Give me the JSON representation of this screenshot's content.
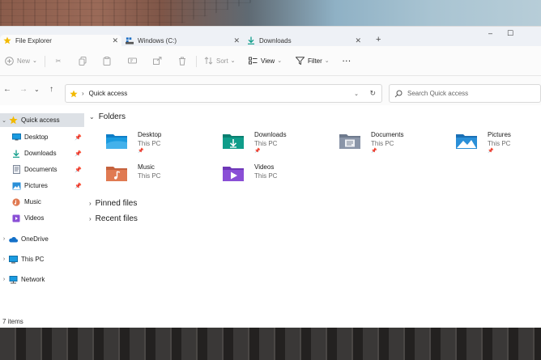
{
  "tabs": [
    {
      "label": "File Explorer",
      "icon": "folder-star-icon",
      "active": true
    },
    {
      "label": "Windows (C:)",
      "icon": "drive-icon",
      "active": false
    },
    {
      "label": "Downloads",
      "icon": "download-icon",
      "active": false
    }
  ],
  "window_controls": {
    "minimize": "–",
    "maximize": "☐"
  },
  "toolbar": {
    "new_label": "New",
    "sort_label": "Sort",
    "view_label": "View",
    "filter_label": "Filter",
    "more_label": "···"
  },
  "address": {
    "location": "Quick access",
    "separator": "›"
  },
  "search": {
    "placeholder": "Search Quick access"
  },
  "nav": {
    "quick_access": "Quick access",
    "pinned": [
      {
        "label": "Desktop",
        "icon": "desktop-icon"
      },
      {
        "label": "Downloads",
        "icon": "download-icon"
      },
      {
        "label": "Documents",
        "icon": "documents-icon"
      },
      {
        "label": "Pictures",
        "icon": "pictures-icon"
      },
      {
        "label": "Music",
        "icon": "music-icon"
      },
      {
        "label": "Videos",
        "icon": "videos-icon"
      }
    ],
    "onedrive": "OneDrive",
    "this_pc": "This PC",
    "network": "Network"
  },
  "main": {
    "folders_header": "Folders",
    "folders": [
      {
        "name": "Desktop",
        "location": "This PC",
        "icon": "desktop-folder-icon",
        "color": "#1a9be0"
      },
      {
        "name": "Downloads",
        "location": "This PC",
        "icon": "downloads-folder-icon",
        "color": "#0f9d8a"
      },
      {
        "name": "Documents",
        "location": "This PC",
        "icon": "documents-folder-icon",
        "color": "#8a95a8"
      },
      {
        "name": "Pictures",
        "location": "This PC",
        "icon": "pictures-folder-icon",
        "color": "#2a8fd8"
      },
      {
        "name": "Music",
        "location": "This PC",
        "icon": "music-folder-icon",
        "color": "#e07a52"
      },
      {
        "name": "Videos",
        "location": "This PC",
        "icon": "videos-folder-icon",
        "color": "#8a4fd6"
      }
    ],
    "pinned_files_header": "Pinned files",
    "recent_files_header": "Recent files"
  },
  "status": {
    "items": "7 items"
  },
  "colors": {
    "accent": "#0067c0",
    "selected_nav": "#dde1e6",
    "star": "#f2b900"
  }
}
